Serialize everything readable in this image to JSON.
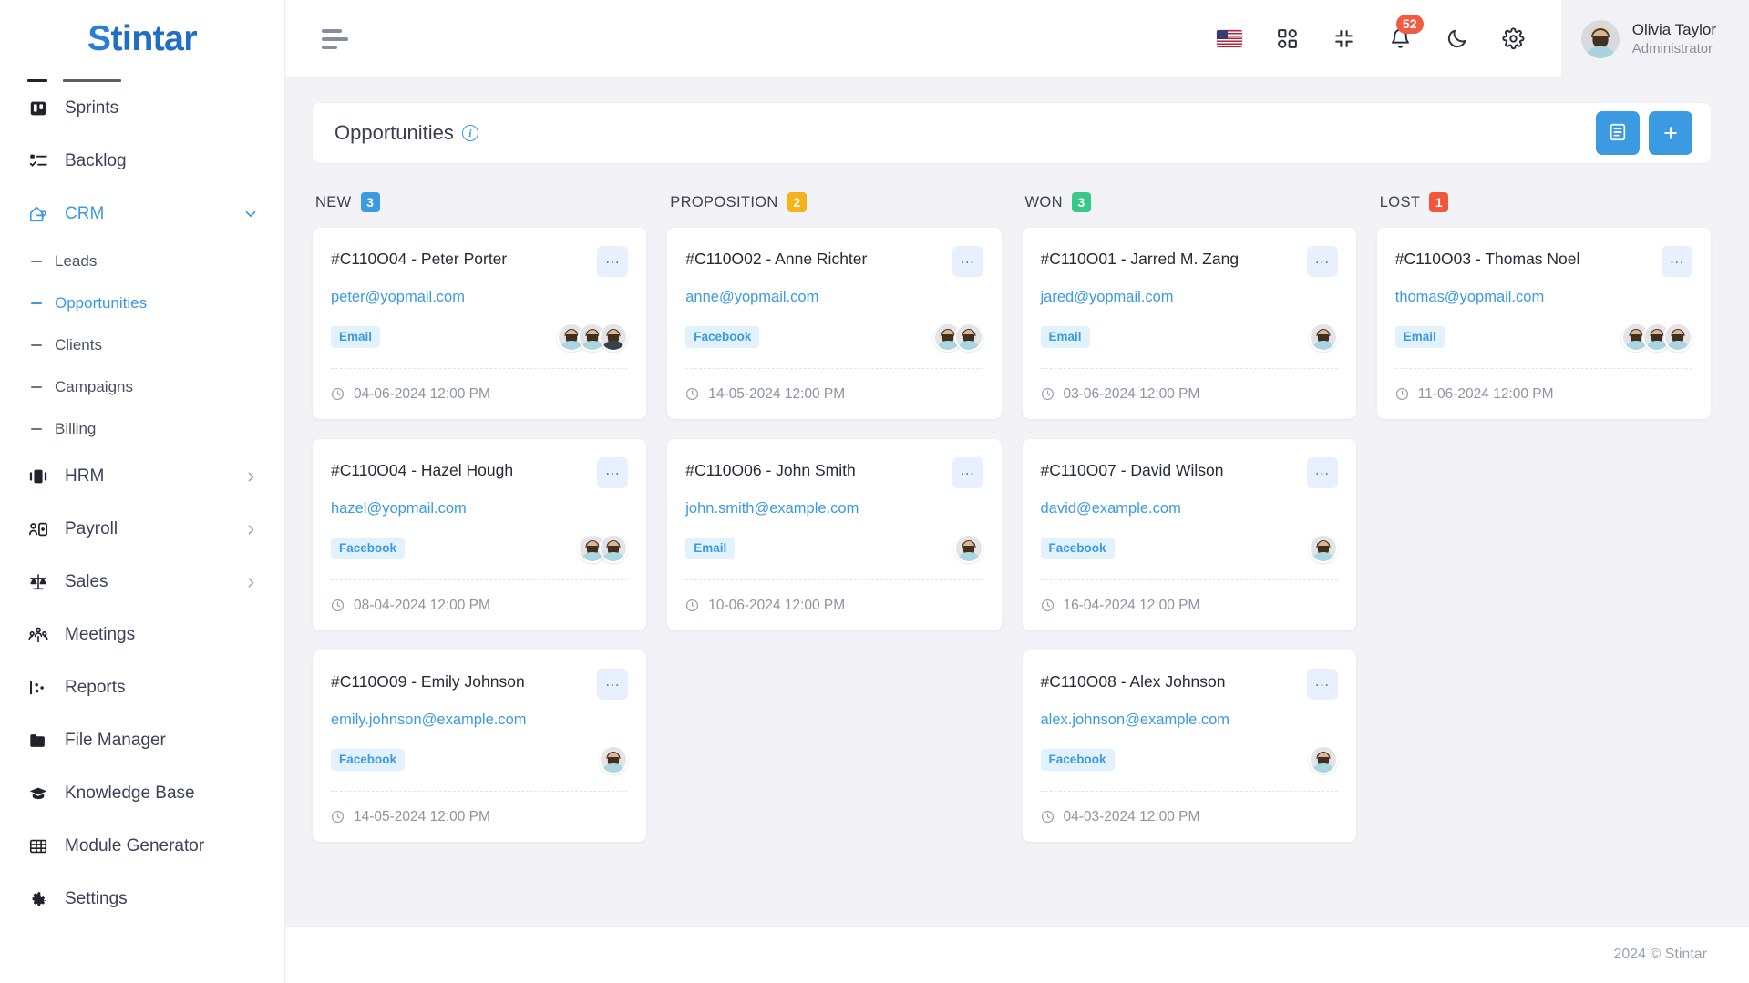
{
  "brand": {
    "name": "Stintar",
    "first_letter": "S",
    "rest": "tintar"
  },
  "sidebar": {
    "items": [
      {
        "label": "Sprints",
        "icon": "sprints-icon",
        "active": false,
        "chevron": ""
      },
      {
        "label": "Backlog",
        "icon": "backlog-icon",
        "active": false,
        "chevron": ""
      },
      {
        "label": "CRM",
        "icon": "crm-icon",
        "active": true,
        "chevron": "down"
      }
    ],
    "crm_children": [
      {
        "label": "Leads",
        "active": false
      },
      {
        "label": "Opportunities",
        "active": true
      },
      {
        "label": "Clients",
        "active": false
      },
      {
        "label": "Campaigns",
        "active": false
      },
      {
        "label": "Billing",
        "active": false
      }
    ],
    "items_bottom": [
      {
        "label": "HRM",
        "icon": "hrm-icon",
        "chevron": "right"
      },
      {
        "label": "Payroll",
        "icon": "payroll-icon",
        "chevron": "right"
      },
      {
        "label": "Sales",
        "icon": "sales-icon",
        "chevron": "right"
      },
      {
        "label": "Meetings",
        "icon": "meetings-icon",
        "chevron": ""
      },
      {
        "label": "Reports",
        "icon": "reports-icon",
        "chevron": ""
      },
      {
        "label": "File Manager",
        "icon": "folder-icon",
        "chevron": ""
      },
      {
        "label": "Knowledge Base",
        "icon": "graduation-cap-icon",
        "chevron": ""
      },
      {
        "label": "Module Generator",
        "icon": "grid-table-icon",
        "chevron": ""
      },
      {
        "label": "Settings",
        "icon": "gear-icon",
        "chevron": ""
      }
    ]
  },
  "topbar": {
    "menu_toggle": "hamburger-icon",
    "language_flag": "us-flag-icon",
    "apps_icon": "apps-grid-icon",
    "fullscreen_icon": "collapse-fullscreen-icon",
    "notifications_icon": "bell-icon",
    "notifications_count": "52",
    "theme_icon": "moon-icon",
    "settings_icon": "gear-icon",
    "profile": {
      "name": "Olivia Taylor",
      "role": "Administrator",
      "avatar": "user-avatar"
    }
  },
  "page": {
    "title": "Opportunities",
    "info_icon": "info-icon",
    "list_view_label": "list-view-icon",
    "add_label": "+"
  },
  "board": {
    "columns": [
      {
        "name": "NEW",
        "count": "3",
        "color": "#3b9ae1",
        "cards": [
          {
            "title": "#C110O04 - Peter Porter",
            "email": "peter@yopmail.com",
            "tag": "Email",
            "date": "04-06-2024 12:00 PM",
            "avatars": 3,
            "menu": "..."
          },
          {
            "title": "#C110O04 - Hazel Hough",
            "email": "hazel@yopmail.com",
            "tag": "Facebook",
            "date": "08-04-2024 12:00 PM",
            "avatars": 2,
            "menu": "..."
          },
          {
            "title": "#C110O09 - Emily Johnson",
            "email": "emily.johnson@example.com",
            "tag": "Facebook",
            "date": "14-05-2024 12:00 PM",
            "avatars": 1,
            "menu": "..."
          }
        ]
      },
      {
        "name": "PROPOSITION",
        "count": "2",
        "color": "#f5b31b",
        "cards": [
          {
            "title": "#C110O02 - Anne Richter",
            "email": "anne@yopmail.com",
            "tag": "Facebook",
            "date": "14-05-2024 12:00 PM",
            "avatars": 2,
            "menu": "..."
          },
          {
            "title": "#C110O06 - John Smith",
            "email": "john.smith@example.com",
            "tag": "Email",
            "date": "10-06-2024 12:00 PM",
            "avatars": 1,
            "menu": "..."
          }
        ]
      },
      {
        "name": "WON",
        "count": "3",
        "color": "#37c98a",
        "cards": [
          {
            "title": "#C110O01 - Jarred M. Zang",
            "email": "jared@yopmail.com",
            "tag": "Email",
            "date": "03-06-2024 12:00 PM",
            "avatars": 1,
            "menu": "..."
          },
          {
            "title": "#C110O07 - David Wilson",
            "email": "david@example.com",
            "tag": "Facebook",
            "date": "16-04-2024 12:00 PM",
            "avatars": 1,
            "menu": "..."
          },
          {
            "title": "#C110O08 - Alex Johnson",
            "email": "alex.johnson@example.com",
            "tag": "Facebook",
            "date": "04-03-2024 12:00 PM",
            "avatars": 1,
            "menu": "..."
          }
        ]
      },
      {
        "name": "LOST",
        "count": "1",
        "color": "#f4563b",
        "cards": [
          {
            "title": "#C110O03 - Thomas Noel",
            "email": "thomas@yopmail.com",
            "tag": "Email",
            "date": "11-06-2024 12:00 PM",
            "avatars": 3,
            "menu": "..."
          }
        ]
      }
    ]
  },
  "footer": {
    "copyright": "2024 © Stintar"
  }
}
